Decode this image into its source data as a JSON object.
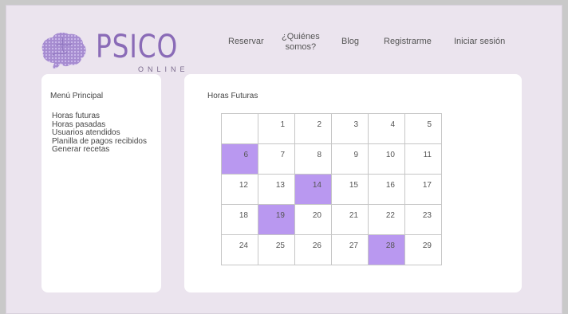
{
  "brand": {
    "name": "PSICO",
    "tagline": "ONLINE",
    "accent_color": "#8a6bb7",
    "icon": "brain-icon"
  },
  "nav": [
    {
      "id": "reservar",
      "label": "Reservar"
    },
    {
      "id": "quienes",
      "label": "¿Quiénes\nsomos?"
    },
    {
      "id": "blog",
      "label": "Blog"
    },
    {
      "id": "registrarme",
      "label": "Registrarme"
    },
    {
      "id": "login",
      "label": "Iniciar sesión"
    }
  ],
  "sidebar": {
    "title": "Menú Principal",
    "items": [
      {
        "label": "Horas futuras"
      },
      {
        "label": "Horas pasadas"
      },
      {
        "label": "Usuarios atendidos"
      },
      {
        "label": "Planilla de pagos recibidos"
      },
      {
        "label": "Generar recetas"
      }
    ]
  },
  "main": {
    "title": "Horas Futuras",
    "highlight_color": "#b998f0",
    "calendar": [
      [
        "",
        "1",
        "2",
        "3",
        "4",
        "5"
      ],
      [
        "6",
        "7",
        "8",
        "9",
        "10",
        "11"
      ],
      [
        "12",
        "13",
        "14",
        "15",
        "16",
        "17"
      ],
      [
        "18",
        "19",
        "20",
        "21",
        "22",
        "23"
      ],
      [
        "24",
        "25",
        "26",
        "27",
        "28",
        "29"
      ]
    ],
    "booked_days": [
      "6",
      "14",
      "19",
      "28"
    ]
  }
}
